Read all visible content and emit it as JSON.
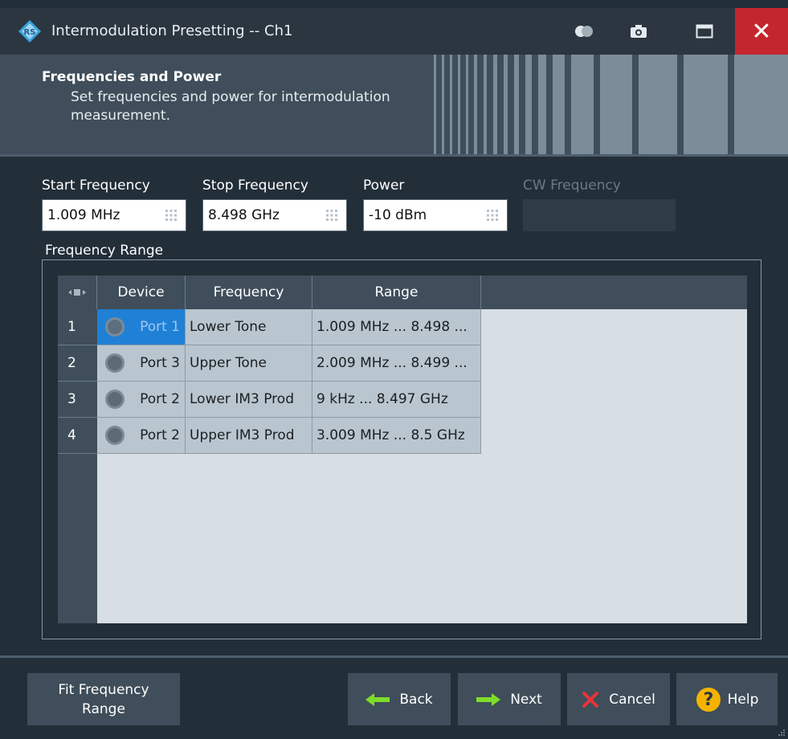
{
  "window": {
    "title": "Intermodulation Presetting -- Ch1",
    "close_symbol": "✕"
  },
  "header": {
    "title": "Frequencies and Power",
    "description": "Set frequencies and power for intermodulation measurement."
  },
  "fields": {
    "start": {
      "label": "Start Frequency",
      "value": "1.009 MHz"
    },
    "stop": {
      "label": "Stop Frequency",
      "value": "8.498 GHz"
    },
    "power": {
      "label": "Power",
      "value": "-10 dBm"
    },
    "cw": {
      "label": "CW Frequency",
      "value": ""
    }
  },
  "frequency_range": {
    "label": "Frequency Range",
    "columns": [
      "Device",
      "Frequency",
      "Range"
    ],
    "rows": [
      {
        "num": "1",
        "device": "Port 1",
        "frequency": "Lower Tone",
        "range": "1.009 MHz ... 8.498 ..."
      },
      {
        "num": "2",
        "device": "Port 3",
        "frequency": "Upper Tone",
        "range": "2.009 MHz ... 8.499 ..."
      },
      {
        "num": "3",
        "device": "Port 2",
        "frequency": "Lower IM3 Prod",
        "range": "9 kHz ... 8.497 GHz"
      },
      {
        "num": "4",
        "device": "Port 2",
        "frequency": "Upper IM3 Prod",
        "range": "3.009 MHz ... 8.5 GHz"
      }
    ]
  },
  "buttons": {
    "fit_line1": "Fit Frequency",
    "fit_line2": "Range",
    "back": "Back",
    "next": "Next",
    "cancel": "Cancel",
    "help": "Help"
  },
  "icons": {
    "back": "arrow-left-icon",
    "next": "arrow-right-icon",
    "cancel": "x-icon",
    "help": "question-icon"
  },
  "colors": {
    "close": "#c4262e",
    "selected": "#1f80d6",
    "arrow": "#7fdd2a",
    "cancel": "#e8333b",
    "help": "#f5b300"
  }
}
